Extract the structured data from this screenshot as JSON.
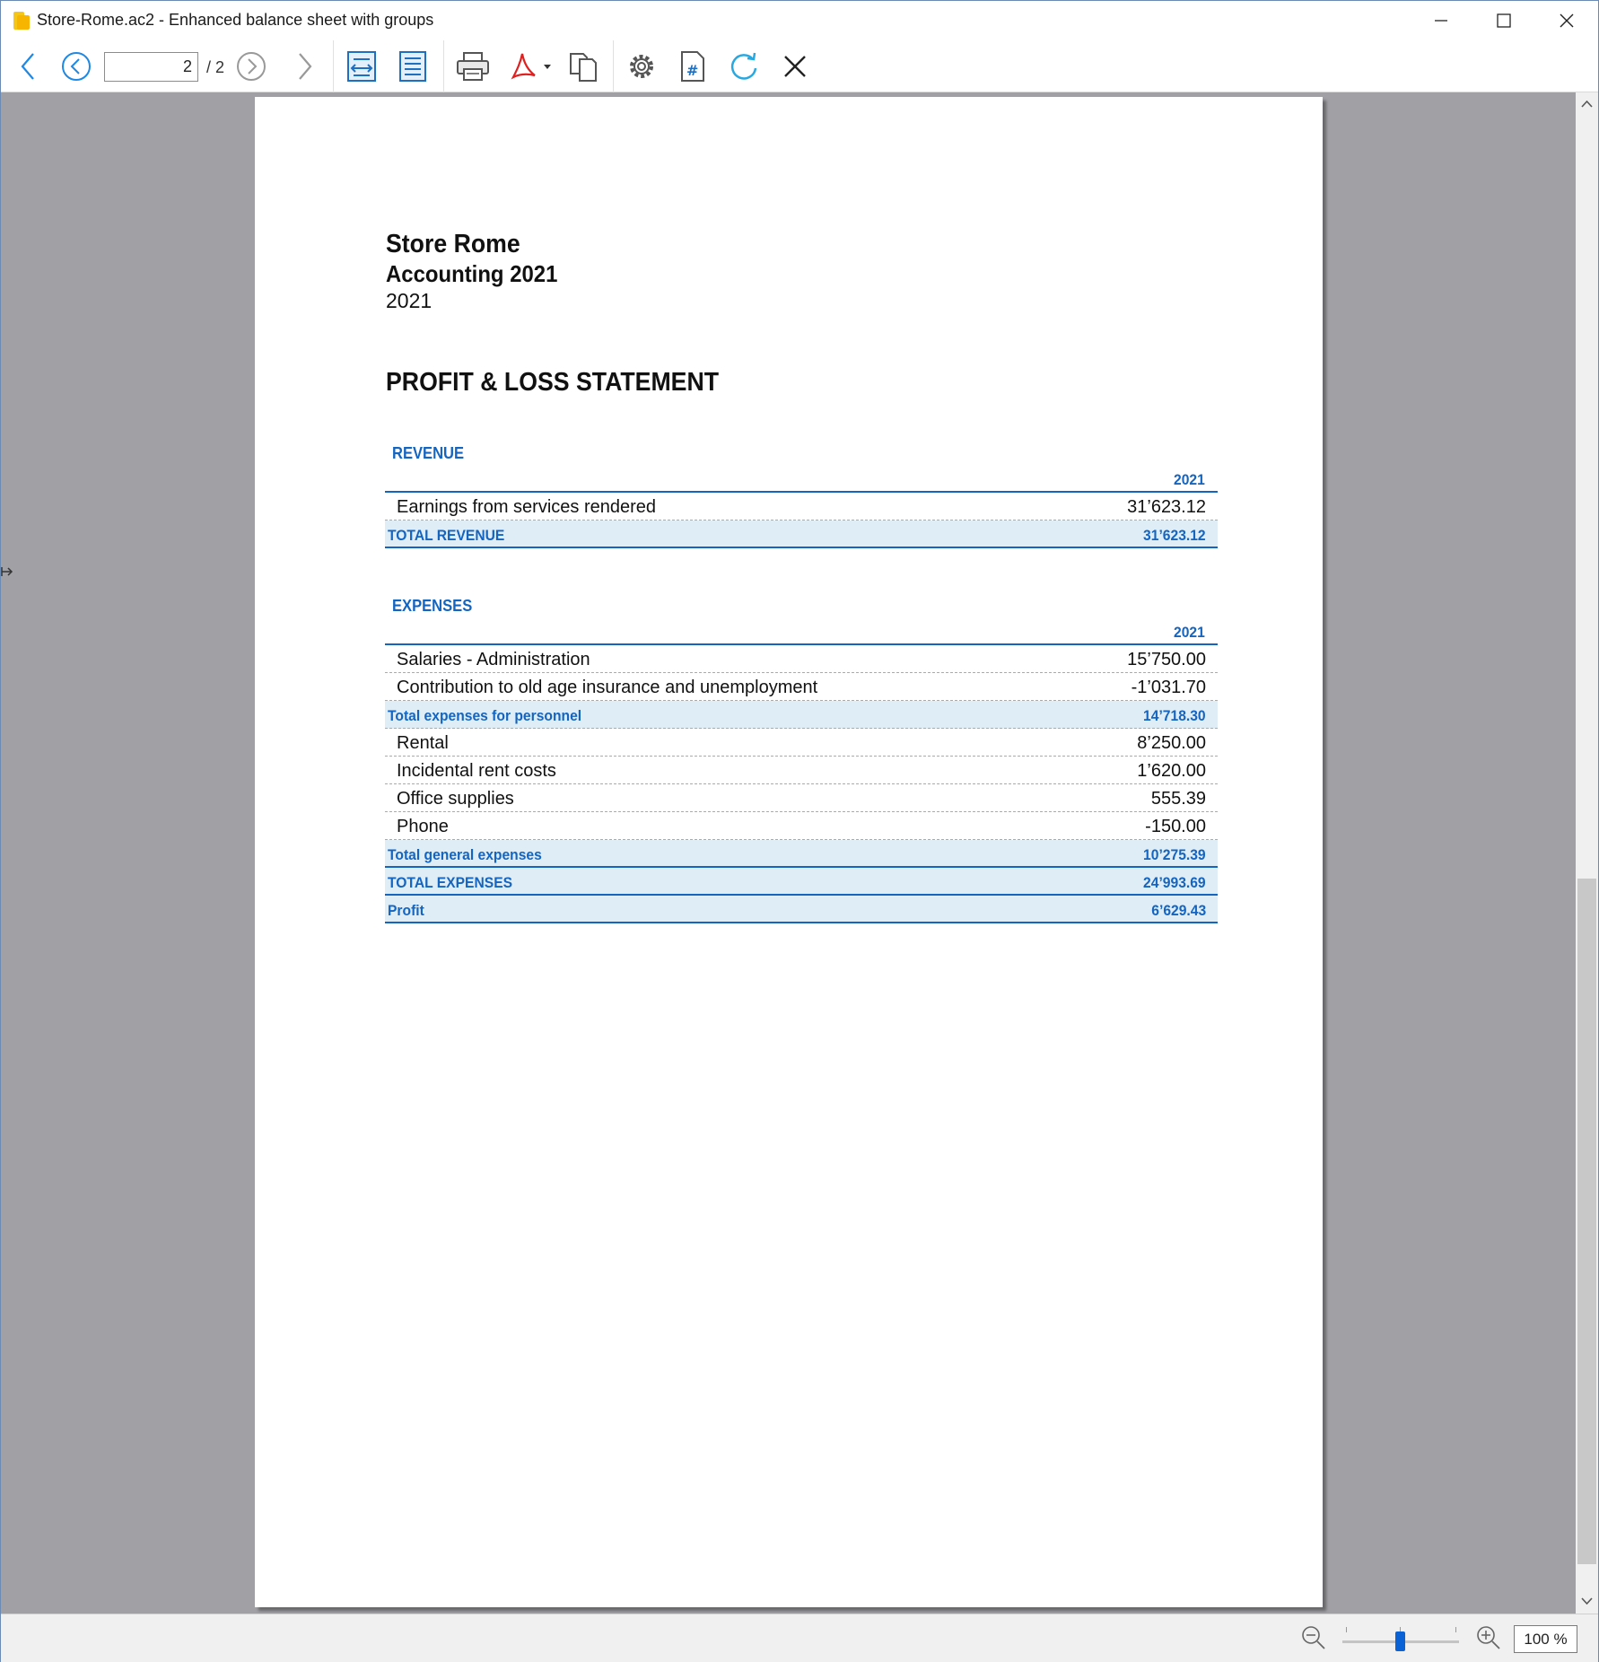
{
  "window": {
    "title": "Store-Rome.ac2 - Enhanced balance sheet with groups"
  },
  "toolbar": {
    "current_page": "2",
    "total_pages": "/ 2",
    "icons": [
      "back-arrow-icon",
      "previous-page-icon",
      "next-page-icon",
      "forward-arrow-icon",
      "fit-width-icon",
      "fit-page-icon",
      "print-icon",
      "pdf-export-icon",
      "copy-pages-icon",
      "settings-gear-icon",
      "page-number-icon",
      "refresh-icon",
      "close-icon"
    ]
  },
  "report": {
    "company": "Store Rome",
    "accounting": "Accounting 2021",
    "year": "2021",
    "title": "PROFIT & LOSS STATEMENT",
    "revenue": {
      "heading": "REVENUE",
      "column": "2021",
      "rows": [
        {
          "label": "Earnings from services rendered",
          "amount": "31’623.12"
        }
      ],
      "total": {
        "label": "TOTAL REVENUE",
        "amount": "31’623.12"
      }
    },
    "expenses": {
      "heading": "EXPENSES",
      "column": "2021",
      "rows": [
        {
          "label": "Salaries - Administration",
          "amount": "15’750.00"
        },
        {
          "label": "Contribution to old age insurance and unemployment",
          "amount": "-1’031.70"
        }
      ],
      "subtotal_personnel": {
        "label": "Total expenses for personnel",
        "amount": "14’718.30"
      },
      "rows2": [
        {
          "label": "Rental",
          "amount": "8’250.00"
        },
        {
          "label": "Incidental rent costs",
          "amount": "1’620.00"
        },
        {
          "label": "Office supplies",
          "amount": "555.39"
        },
        {
          "label": "Phone",
          "amount": "-150.00"
        }
      ],
      "subtotal_general": {
        "label": "Total general expenses",
        "amount": "10’275.39"
      },
      "total": {
        "label": "TOTAL EXPENSES",
        "amount": "24’993.69"
      },
      "profit": {
        "label": "Profit",
        "amount": "6’629.43"
      }
    }
  },
  "statusbar": {
    "zoom": "100 %",
    "zoom_level": 0.5
  },
  "colors": {
    "accent": "#1565c0",
    "total_row_bg": "#deedf6",
    "viewport_bg": "#a0a0a5"
  }
}
